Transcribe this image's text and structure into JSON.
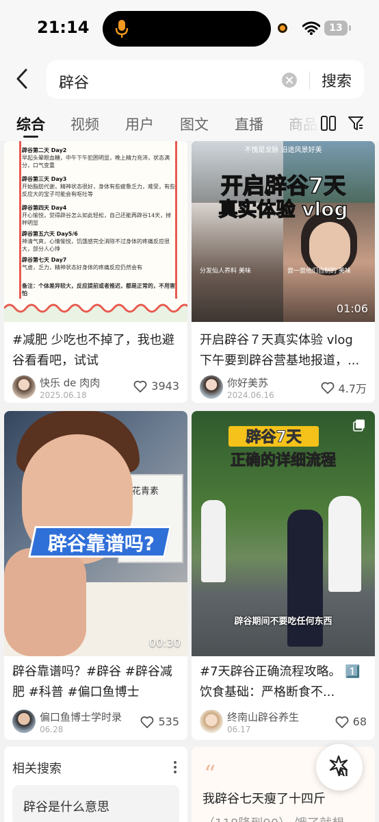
{
  "status": {
    "time": "21:14",
    "battery": "13"
  },
  "search": {
    "query": "辟谷",
    "button": "搜索"
  },
  "tabs": [
    {
      "label": "综合",
      "active": true
    },
    {
      "label": "视频"
    },
    {
      "label": "用户"
    },
    {
      "label": "图文"
    },
    {
      "label": "直播"
    },
    {
      "label": "商品"
    }
  ],
  "cards": [
    {
      "title": "#减肥 少吃也不掉了，我也避谷看看吧，试试",
      "author": "快乐 de 肉肉",
      "date": "2025.06.18",
      "likes": "3943",
      "doc": [
        {
          "h": "辟谷第二天   Day2",
          "t": "早起头晕眼血糖，中午下午犯困明显，晚上精力充沛，状态满分，口气变重"
        },
        {
          "h": "辟谷第三天   Day3",
          "t": "开始脂肪代谢，精神状态很好，身体有些疲惫乏力，难受，有些反应大的宝子可能会有呕吐等"
        },
        {
          "h": "辟谷第四天   Day4",
          "t": "开心愉悦，觉得辟谷怎么如此轻松，自己还能再辟谷14天，掉秤明显"
        },
        {
          "h": "辟谷第五六天  Day5/6",
          "t": "神清气爽，心情愉悦，饥饿感完全消除不过身体的疼痛反应很大，部分人心悸"
        },
        {
          "h": "辟谷第七天   Day7",
          "t": "气虚，乏力，精神状态好身体的疼痛反应仍然会有"
        },
        {
          "h": "",
          "t": "备注：个体差异较大，反应提前或者推迟，都是正常的，不用害怕"
        }
      ]
    },
    {
      "title": "开启辟谷７天真实体验 vlog 下午要到辟谷营基地报道，...",
      "author": "你好美苏",
      "date": "2024.06.16",
      "likes": "4.7万",
      "duration": "01:06",
      "overlay1": "开启辟谷7天",
      "overlay2": "真实体验 vlog",
      "caption_top": "不愧是龙脉 沿途风景好美",
      "caption_left": "分发仙人养料 美味",
      "caption_right": "尝一尝他们自制的 美味"
    },
    {
      "title": "辟谷靠谱吗？#辟谷 #辟谷减肥 #科普 #偏口鱼博士",
      "author": "偏口鱼博士学时录",
      "date": "06.28",
      "likes": "535",
      "duration": "00:30",
      "overlay": "辟谷靠谱吗?",
      "board": "→花青素"
    },
    {
      "title": "#7天辟谷正确流程攻略。 1️⃣饮食基础：严格断食不...",
      "author": "终南山辟谷养生",
      "date": "06.17",
      "likes": "68",
      "overlay1": "辟谷7天",
      "overlay2": "正确的详细流程",
      "subtitle": "辟谷期间不要吃任何东西"
    }
  ],
  "related": {
    "title": "相关搜索",
    "item": "辟谷是什么意思"
  },
  "text_card": {
    "line1": "我辟谷七天瘦了十四斤",
    "line2": "（118降到90）  饿了就想"
  },
  "ai": {
    "label": "AI"
  },
  "colors": {
    "accent": "#f4c21a",
    "blue": "#2f6fd8",
    "bg": "#f2f2f2"
  }
}
